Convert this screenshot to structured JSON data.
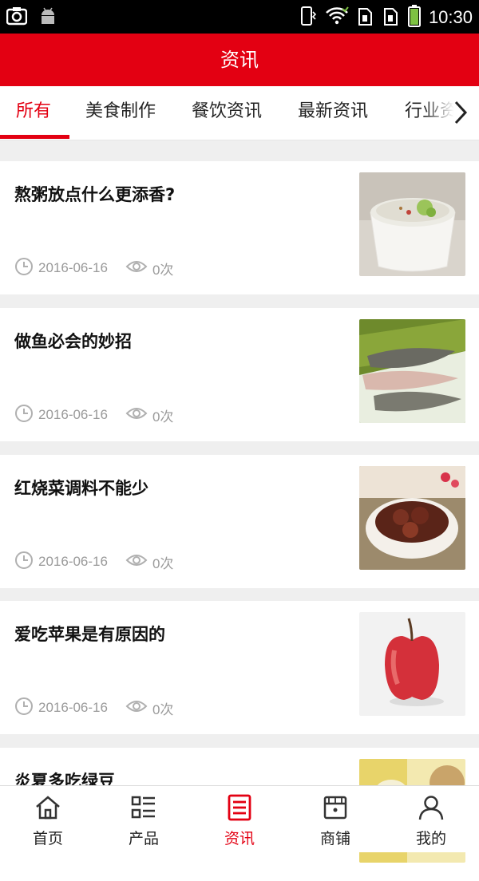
{
  "status_bar": {
    "time": "10:30",
    "icons": [
      "screenshot-icon",
      "android-icon",
      "vibrate-icon",
      "wifi-icon",
      "sim1-icon",
      "sim2-icon",
      "battery-icon"
    ]
  },
  "header": {
    "title": "资讯"
  },
  "tabs": [
    {
      "label": "所有",
      "active": true
    },
    {
      "label": "美食制作",
      "active": false
    },
    {
      "label": "餐饮资讯",
      "active": false
    },
    {
      "label": "最新资讯",
      "active": false
    },
    {
      "label": "行业资讯",
      "active": false
    }
  ],
  "articles": [
    {
      "title": "熬粥放点什么更添香?",
      "date": "2016-06-16",
      "views": "0次",
      "image": "porridge"
    },
    {
      "title": "做鱼必会的妙招",
      "date": "2016-06-16",
      "views": "0次",
      "image": "fish"
    },
    {
      "title": "红烧菜调料不能少",
      "date": "2016-06-16",
      "views": "0次",
      "image": "braised-meat"
    },
    {
      "title": "爱吃苹果是有原因的",
      "date": "2016-06-16",
      "views": "0次",
      "image": "apple"
    },
    {
      "title": "炎夏多吃绿豆",
      "date": "",
      "views": "",
      "image": "mung-bean"
    }
  ],
  "bottom_nav": [
    {
      "label": "首页",
      "icon": "home-icon",
      "active": false
    },
    {
      "label": "产品",
      "icon": "list-icon",
      "active": false
    },
    {
      "label": "资讯",
      "icon": "news-icon",
      "active": true
    },
    {
      "label": "商铺",
      "icon": "shop-icon",
      "active": false
    },
    {
      "label": "我的",
      "icon": "user-icon",
      "active": false
    }
  ],
  "colors": {
    "accent": "#e30012",
    "meta": "#9a9a9a",
    "background": "#efefef"
  }
}
